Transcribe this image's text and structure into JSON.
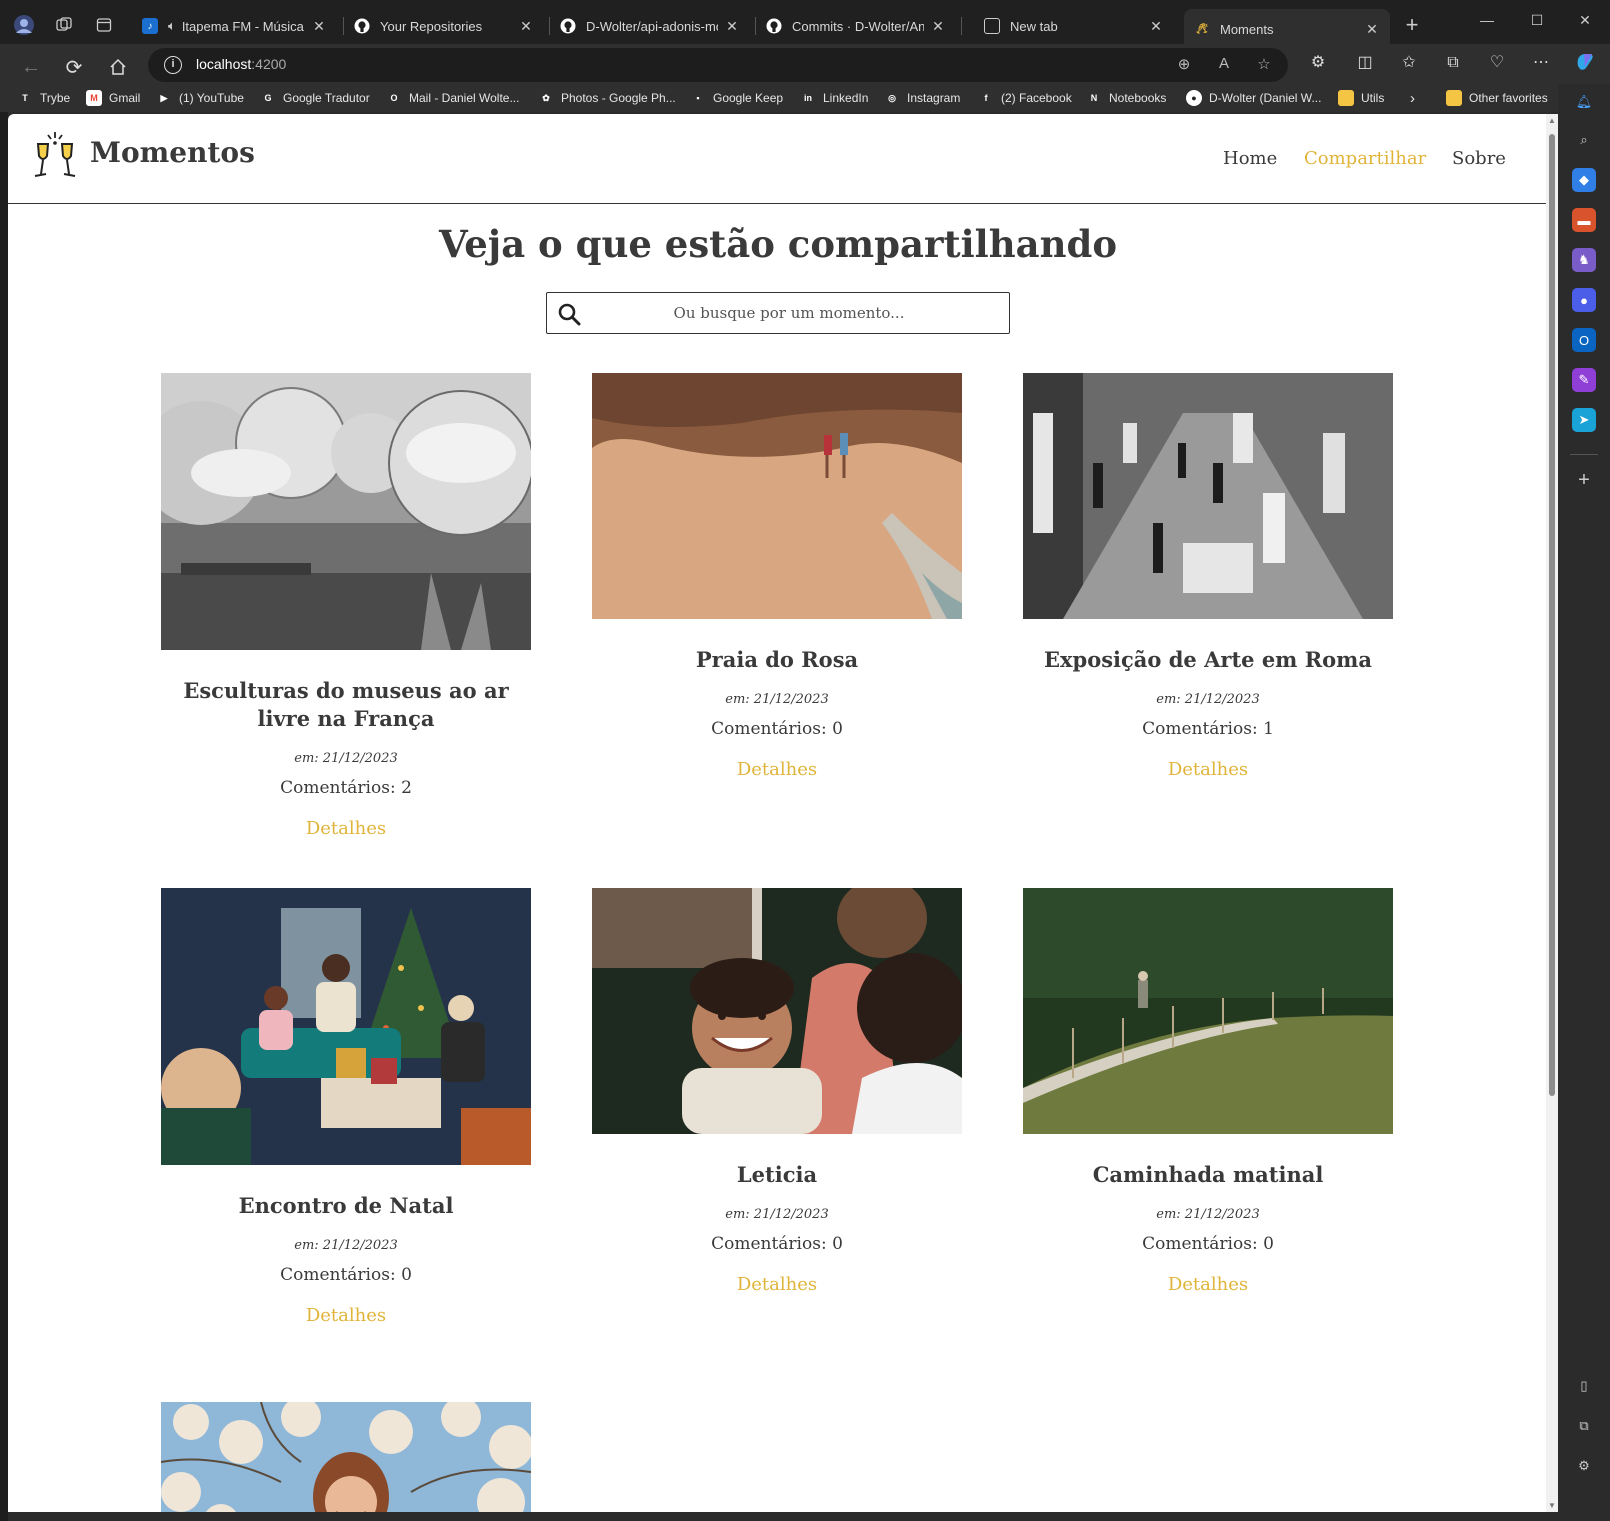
{
  "browser": {
    "tabs": [
      {
        "title": "Itapema FM - Música, ",
        "icon": "itapema-favicon"
      },
      {
        "title": "Your Repositories",
        "icon": "github-favicon"
      },
      {
        "title": "D-Wolter/api-adonis-mome",
        "icon": "github-favicon"
      },
      {
        "title": "Commits · D-Wolter/Angula",
        "icon": "github-favicon"
      },
      {
        "title": "New tab",
        "icon": "newtab-favicon"
      },
      {
        "title": "Moments",
        "icon": "moments-favicon"
      }
    ],
    "new_tab_symbol": "+",
    "url_host": "localhost",
    "url_port": ":4200",
    "bookmarks": [
      {
        "label": "Trybe",
        "color": "#1db954"
      },
      {
        "label": "Gmail",
        "color": "#ea4335"
      },
      {
        "label": "(1) YouTube",
        "color": "#ff0000"
      },
      {
        "label": "Google Tradutor",
        "color": "#4285f4"
      },
      {
        "label": "Mail - Daniel Wolte...",
        "color": "#0a64c2"
      },
      {
        "label": "Photos - Google Ph...",
        "color": "#fbbc04"
      },
      {
        "label": "Google Keep",
        "color": "#fbbc04"
      },
      {
        "label": "LinkedIn",
        "color": "#0a66c2"
      },
      {
        "label": "Instagram",
        "color": "#d6249f"
      },
      {
        "label": "(2) Facebook",
        "color": "#1877f2"
      },
      {
        "label": "Notebooks",
        "color": "#7719aa"
      },
      {
        "label": "D-Wolter (Daniel W...",
        "color": "#333333"
      },
      {
        "label": "Utils",
        "color": "#f4c542"
      }
    ],
    "other_favorites": "Other favorites"
  },
  "site": {
    "brand": "Momentos",
    "nav": {
      "home": "Home",
      "share": "Compartilhar",
      "about": "Sobre"
    },
    "accent_color": "#e0b43a",
    "heading": "Veja o que estão compartilhando",
    "search_placeholder": "Ou busque por um momento...",
    "moments": [
      {
        "title": "Esculturas do museus ao ar livre na França",
        "date": "em: 21/12/2023",
        "comments": "Comentários: 2",
        "details": "Detalhes"
      },
      {
        "title": "Praia do Rosa",
        "date": "em: 21/12/2023",
        "comments": "Comentários: 0",
        "details": "Detalhes"
      },
      {
        "title": "Exposição de Arte em Roma",
        "date": "em: 21/12/2023",
        "comments": "Comentários: 1",
        "details": "Detalhes"
      },
      {
        "title": "Encontro de Natal",
        "date": "em: 21/12/2023",
        "comments": "Comentários: 0",
        "details": "Detalhes"
      },
      {
        "title": "Leticia",
        "date": "em: 21/12/2023",
        "comments": "Comentários: 0",
        "details": "Detalhes"
      },
      {
        "title": "Caminhada matinal",
        "date": "em: 21/12/2023",
        "comments": "Comentários: 0",
        "details": "Detalhes"
      }
    ]
  }
}
